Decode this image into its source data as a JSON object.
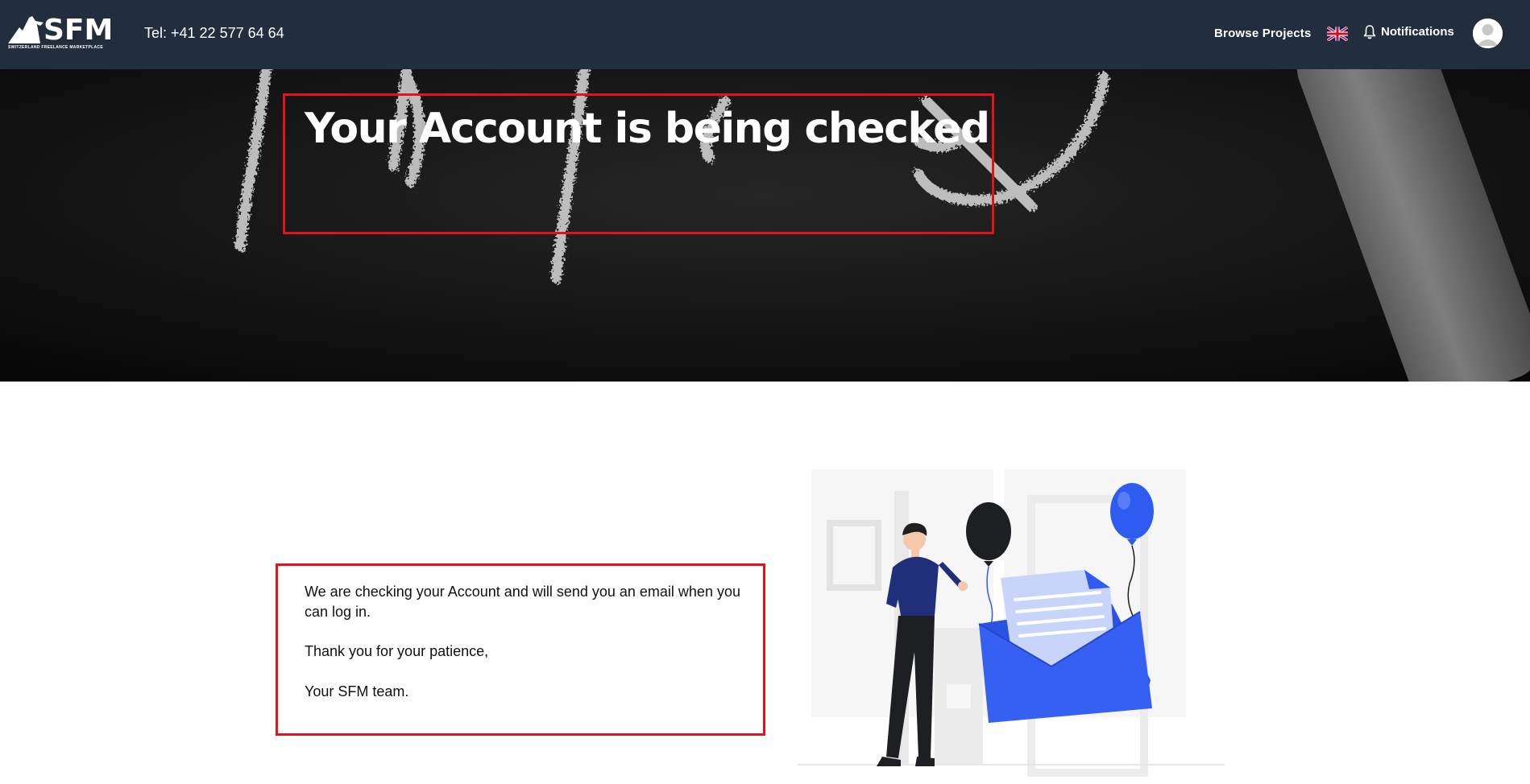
{
  "header": {
    "logo_text": "SFM",
    "logo_subtitle": "SWITZERLAND FREELANCE MARKETPLACE",
    "phone": "Tel: +41 22 577 64 64",
    "browse_projects": "Browse Projects",
    "notifications": "Notifications"
  },
  "hero": {
    "title": "Your Account is being checked"
  },
  "message": {
    "line1": "We are checking your Account and will send you an email when you can log in.",
    "line2": "Thank you for your patience,",
    "line3": "Your SFM team."
  },
  "colors": {
    "topbar": "#222e3d",
    "highlight_border": "#e0141b",
    "illustration_blue": "#2f5cf0"
  },
  "icons": [
    "mountain-logo-icon",
    "uk-flag-icon",
    "bell-icon",
    "user-avatar-icon"
  ]
}
